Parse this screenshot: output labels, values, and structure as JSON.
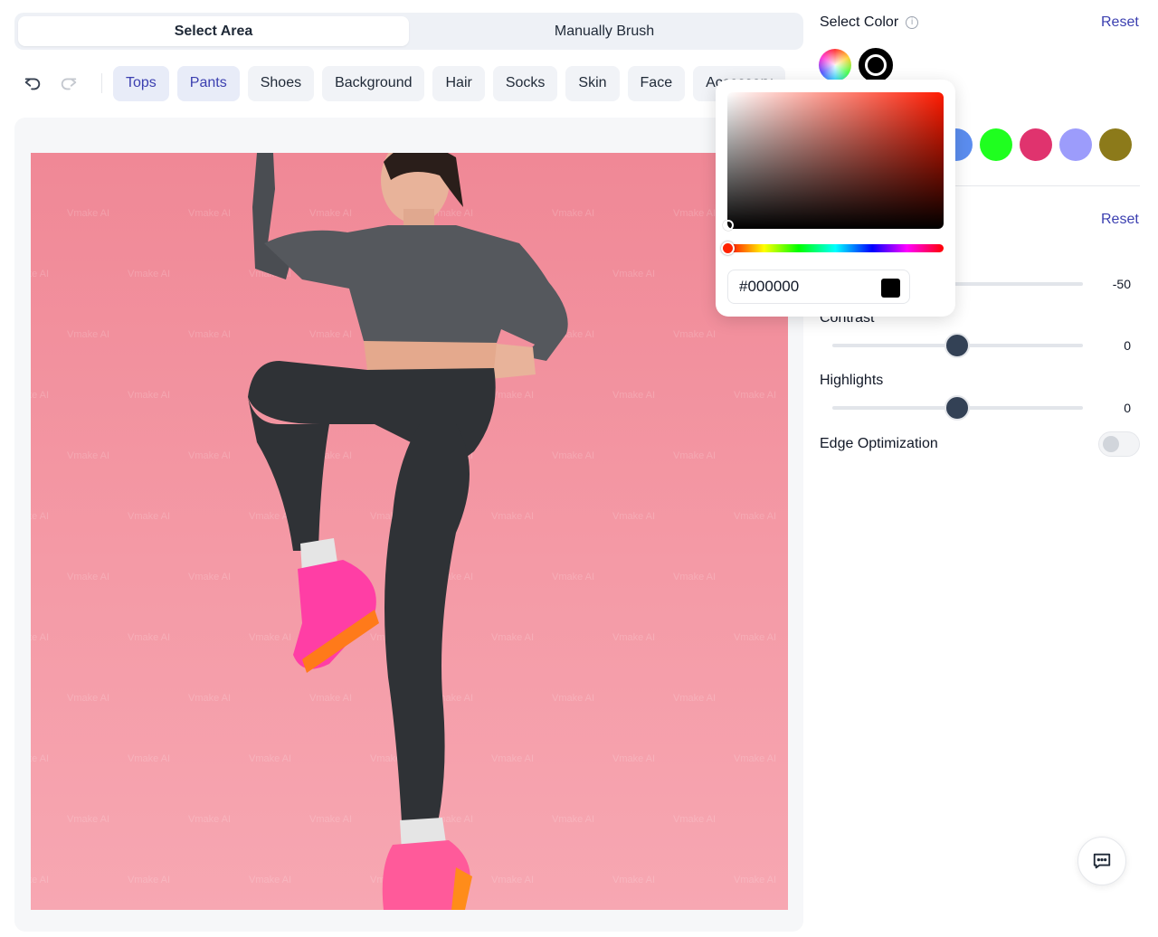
{
  "mode_toggle": {
    "select_area": "Select Area",
    "manually_brush": "Manually Brush",
    "active": "select_area"
  },
  "toolbar": {
    "undo_icon": "undo-icon",
    "redo_icon": "redo-icon",
    "chips": [
      {
        "label": "Tops",
        "active": true
      },
      {
        "label": "Pants",
        "active": true
      },
      {
        "label": "Shoes",
        "active": false
      },
      {
        "label": "Background",
        "active": false
      },
      {
        "label": "Hair",
        "active": false
      },
      {
        "label": "Socks",
        "active": false
      },
      {
        "label": "Skin",
        "active": false
      },
      {
        "label": "Face",
        "active": false
      },
      {
        "label": "Accessory",
        "active": false
      }
    ]
  },
  "canvas": {
    "watermark": "Vmake AI"
  },
  "panel": {
    "select_color_title": "Select Color",
    "reset_label": "Reset",
    "swatches": [
      "#5b8def",
      "#1fff1f",
      "#e0336e",
      "#9c9cfb",
      "#8c7a1a"
    ],
    "selected_color": "#000000",
    "adjust_reset_label": "Reset",
    "sliders": [
      {
        "label": "",
        "value": "-50"
      },
      {
        "label": "Contrast",
        "value": "0"
      },
      {
        "label": "Highlights",
        "value": "0"
      }
    ],
    "edge_optimization_label": "Edge Optimization",
    "edge_optimization_on": false
  },
  "color_picker": {
    "hex_value": "#000000",
    "hue_color": "#ff0000"
  },
  "chat_icon": "chat-icon",
  "colors": {
    "accent": "#3b3fb0",
    "knob": "#334155",
    "photo_bg": "#f08896"
  }
}
